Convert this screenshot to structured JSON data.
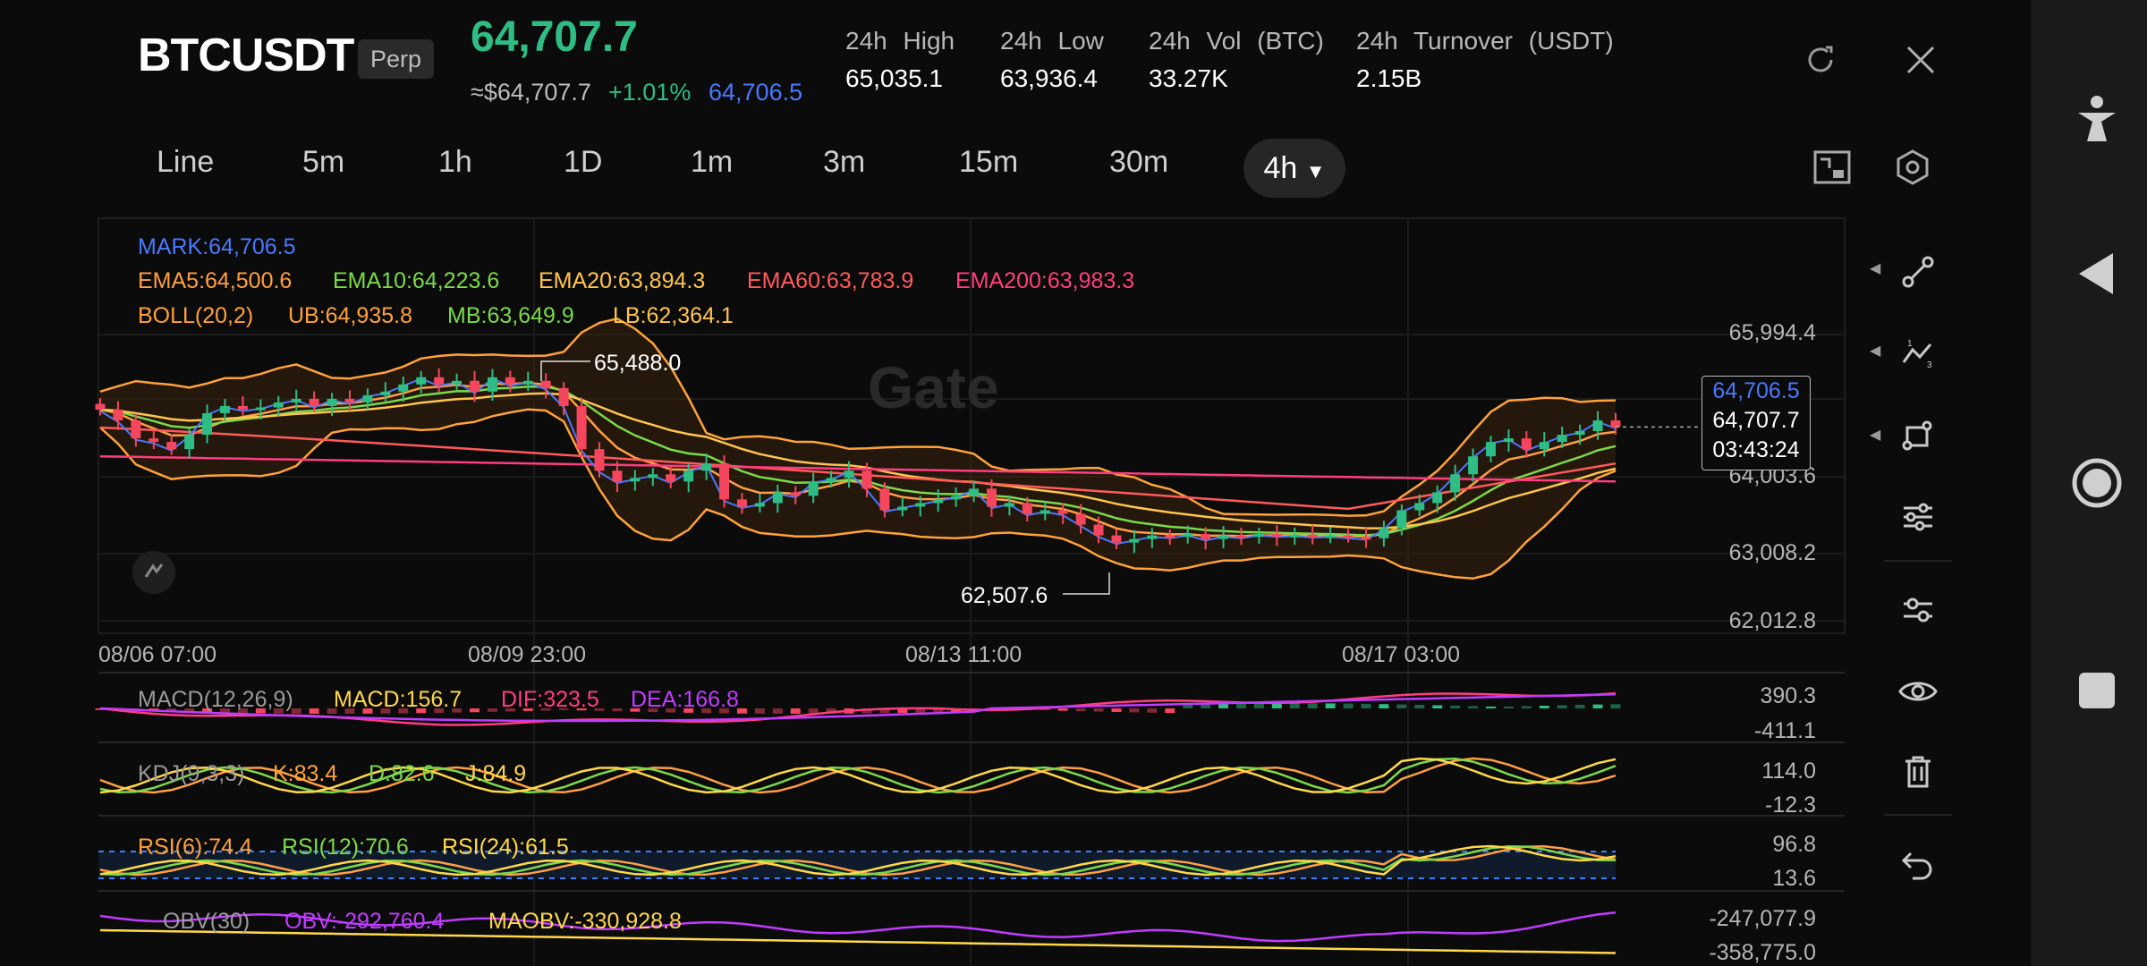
{
  "header": {
    "symbol": "BTCUSDT",
    "contract_type": "Perp",
    "last_price": "64,707.7",
    "usd_price": "≈$64,707.7",
    "change_pct": "+1.01%",
    "mark_price": "64,706.5",
    "stats": [
      {
        "label": "24h High",
        "value": "65,035.1"
      },
      {
        "label": "24h Low",
        "value": "63,936.4"
      },
      {
        "label": "24h Vol (BTC)",
        "value": "33.27K"
      },
      {
        "label": "24h Turnover (USDT)",
        "value": "2.15B"
      }
    ]
  },
  "timeframes": [
    "Line",
    "5m",
    "1h",
    "1D",
    "1m",
    "3m",
    "15m",
    "30m"
  ],
  "active_timeframe": "4h",
  "main_legend": {
    "mark": "MARK:64,706.5",
    "ema": [
      "EMA5:64,500.6",
      "EMA10:64,223.6",
      "EMA20:63,894.3",
      "EMA60:63,783.9",
      "EMA200:63,983.3"
    ],
    "boll": [
      "BOLL(20,2)",
      "UB:64,935.8",
      "MB:63,649.9",
      "LB:62,364.1"
    ]
  },
  "watermark": "Gate",
  "price_axis": [
    "65,994.4",
    "64,003.6",
    "63,008.2",
    "62,012.8"
  ],
  "price_box": {
    "mark": "64,706.5",
    "last": "64,707.7",
    "countdown": "03:43:24"
  },
  "high_marker": "65,488.0",
  "low_marker": "62,507.6",
  "time_axis": [
    "08/06 07:00",
    "08/09 23:00",
    "08/13 11:00",
    "08/17 03:00"
  ],
  "indicators": {
    "macd": {
      "labels": [
        "MACD(12,26,9)",
        "MACD:156.7",
        "DIF:323.5",
        "DEA:166.8"
      ],
      "axis": [
        "390.3",
        "-411.1"
      ]
    },
    "kdj": {
      "labels": [
        "KDJ(9,3,3)",
        "K:83.4",
        "D:82.6",
        "J:84.9"
      ],
      "axis": [
        "114.0",
        "-12.3"
      ]
    },
    "rsi": {
      "labels": [
        "RSI(6):74.4",
        "RSI(12):70.6",
        "RSI(24):61.5"
      ],
      "axis": [
        "96.8",
        "13.6"
      ]
    },
    "obv": {
      "labels": [
        "OBV(30)",
        "OBV:-292,760.4",
        "MAOBV:-330,928.8"
      ],
      "axis": [
        "-247,077.9",
        "-358,775.0"
      ]
    }
  },
  "colors": {
    "up": "#2dbd85",
    "down": "#f6465d",
    "mark": "#4a78ff",
    "ema5": "#ff9f43",
    "ema10": "#7bd94a",
    "ema20": "#ffc44d",
    "ema60": "#ff5a5a",
    "ema200": "#ff3d7f",
    "boll": "#ffa23a",
    "macd": "#ffd84a",
    "dif": "#ff3d7f",
    "dea": "#c03cff"
  },
  "chart_data": {
    "type": "candlestick",
    "ylim": [
      62012.8,
      65994.4
    ],
    "close": [
      64950,
      64800,
      64550,
      64500,
      64400,
      64600,
      64900,
      65000,
      64950,
      64980,
      65050,
      65100,
      65000,
      65100,
      65050,
      65150,
      65200,
      65300,
      65400,
      65300,
      65350,
      65200,
      65400,
      65300,
      65350,
      65250,
      65000,
      64400,
      64100,
      63950,
      64000,
      64050,
      63950,
      64100,
      64200,
      63700,
      63600,
      63650,
      63800,
      63750,
      63950,
      64000,
      64100,
      63850,
      63550,
      63600,
      63650,
      63700,
      63750,
      63850,
      63600,
      63650,
      63500,
      63550,
      63500,
      63350,
      63200,
      63100,
      63150,
      63200,
      63180,
      63220,
      63150,
      63200,
      63180,
      63220,
      63200,
      63210,
      63190,
      63200,
      63180,
      63160,
      63300,
      63550,
      63650,
      63800,
      64050,
      64300,
      64500,
      64550,
      64400,
      64500,
      64600,
      64650,
      64800,
      64708
    ]
  }
}
